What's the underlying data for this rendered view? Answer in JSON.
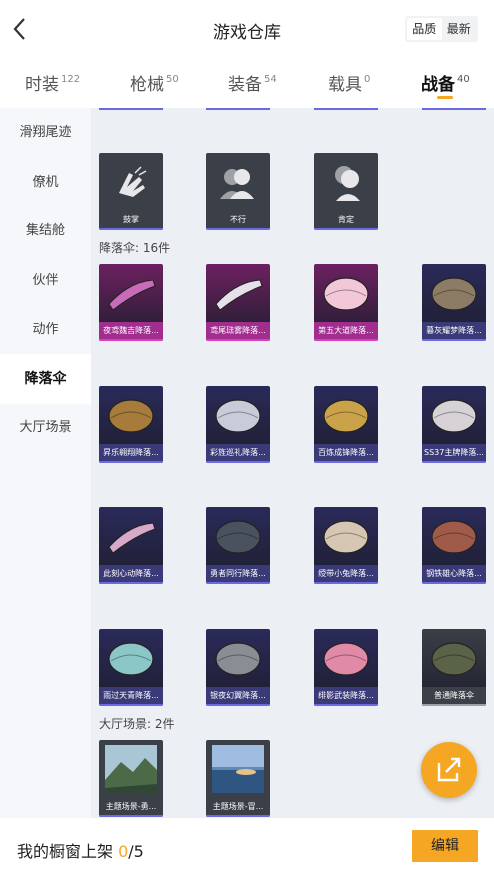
{
  "header": {
    "title": "游戏仓库",
    "sort_quality": "品质",
    "sort_newest": "最新"
  },
  "tabs": [
    {
      "label": "时装",
      "count": "122"
    },
    {
      "label": "枪械",
      "count": "50"
    },
    {
      "label": "装备",
      "count": "54"
    },
    {
      "label": "载具",
      "count": "0"
    },
    {
      "label": "战备",
      "count": "40"
    }
  ],
  "sidebar": {
    "items": [
      "滑翔尾迹",
      "僚机",
      "集结舱",
      "伙伴",
      "动作",
      "降落伞",
      "大厅场景"
    ]
  },
  "sections": {
    "parachute": "降落伞: 16件",
    "lobby": "大厅场景: 2件"
  },
  "emotes": [
    "鼓掌",
    "不行",
    "肯定"
  ],
  "parachutes": [
    "夜鸢魏吉降落...",
    "鸢尾琺雾降落...",
    "第五大道降落...",
    "暮灰耀梦降落...",
    "昇乐翱翔降落...",
    "彩旌巡礼降落...",
    "百炼成锋降落...",
    "SS37主牌降落...",
    "此刻心动降落...",
    "勇者同行降落...",
    "绶带小兔降落...",
    "钢铁雄心降落...",
    "雨过天青降落...",
    "银夜幻翼降落...",
    "绯影武装降落...",
    "普通降落伞"
  ],
  "lobby": [
    "主题场景-勇...",
    "主题场景-冒..."
  ],
  "bottom": {
    "prefix": "我的橱窗上架 ",
    "count": "0",
    "total": "/5",
    "edit": "编辑"
  },
  "colors": {
    "accent": "#f5a623",
    "legendary": "#d63fc4",
    "epic": "#6c6ae0",
    "common": "#9aa0a8"
  },
  "icons": {
    "back": "chevron-left-icon",
    "share": "share-icon"
  }
}
